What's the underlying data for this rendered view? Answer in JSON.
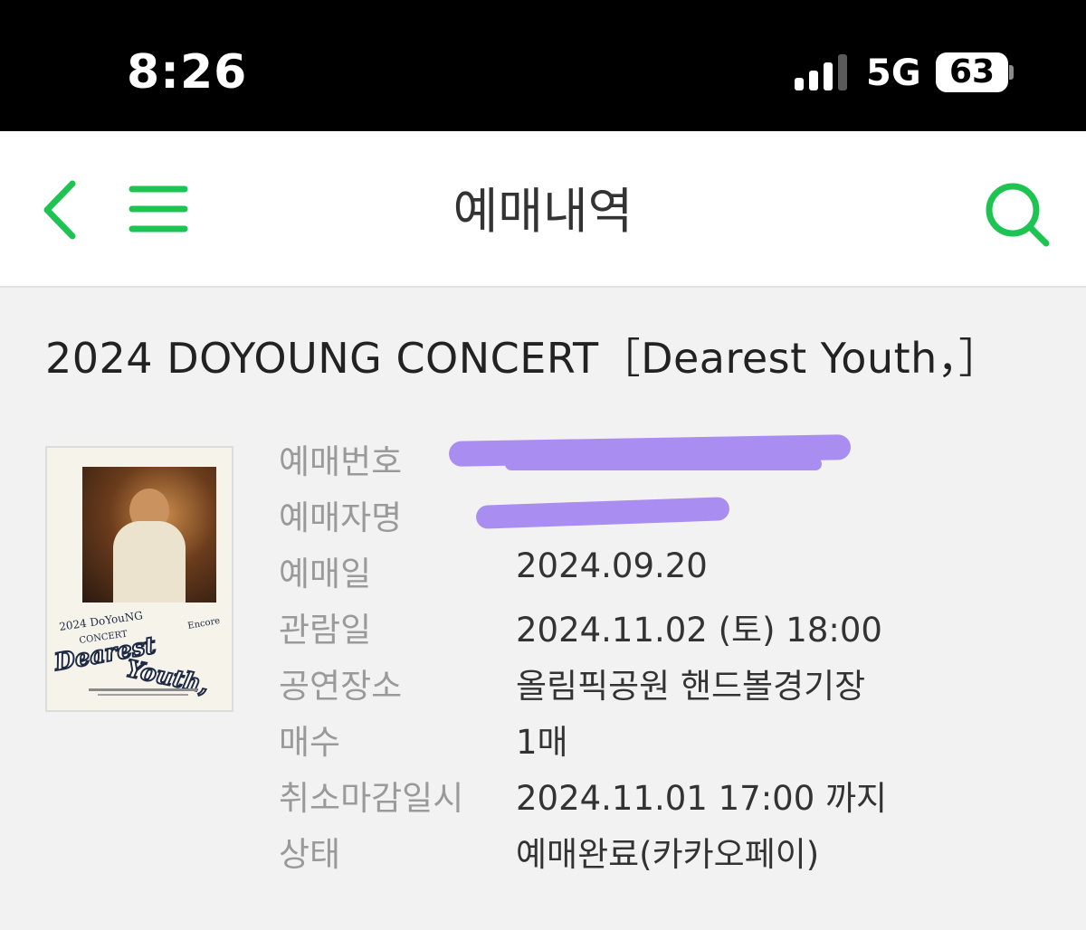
{
  "status_bar": {
    "time": "8:26",
    "network": "5G",
    "battery": "63"
  },
  "nav": {
    "title": "예매내역",
    "back_icon": "chevron-left-icon",
    "menu_icon": "hamburger-icon",
    "search_icon": "search-icon",
    "accent_color": "#1ec452"
  },
  "ticket": {
    "concert_title": "2024 DOYOUNG CONCERT［Dearest Youth，］",
    "poster_caption": "Dearest Youth,",
    "rows": [
      {
        "label": "예매번호",
        "value": ""
      },
      {
        "label": "예매자명",
        "value": ""
      },
      {
        "label": "예매일",
        "value": "2024.09.20"
      },
      {
        "label": "관람일",
        "value": "2024.11.02 (토) 18:00"
      },
      {
        "label": "공연장소",
        "value": "올림픽공원 핸드볼경기장"
      },
      {
        "label": "매수",
        "value": "1매"
      },
      {
        "label": "취소마감일시",
        "value": "2024.11.01 17:00 까지"
      },
      {
        "label": "상태",
        "value": "예매완료(카카오페이)"
      }
    ]
  }
}
